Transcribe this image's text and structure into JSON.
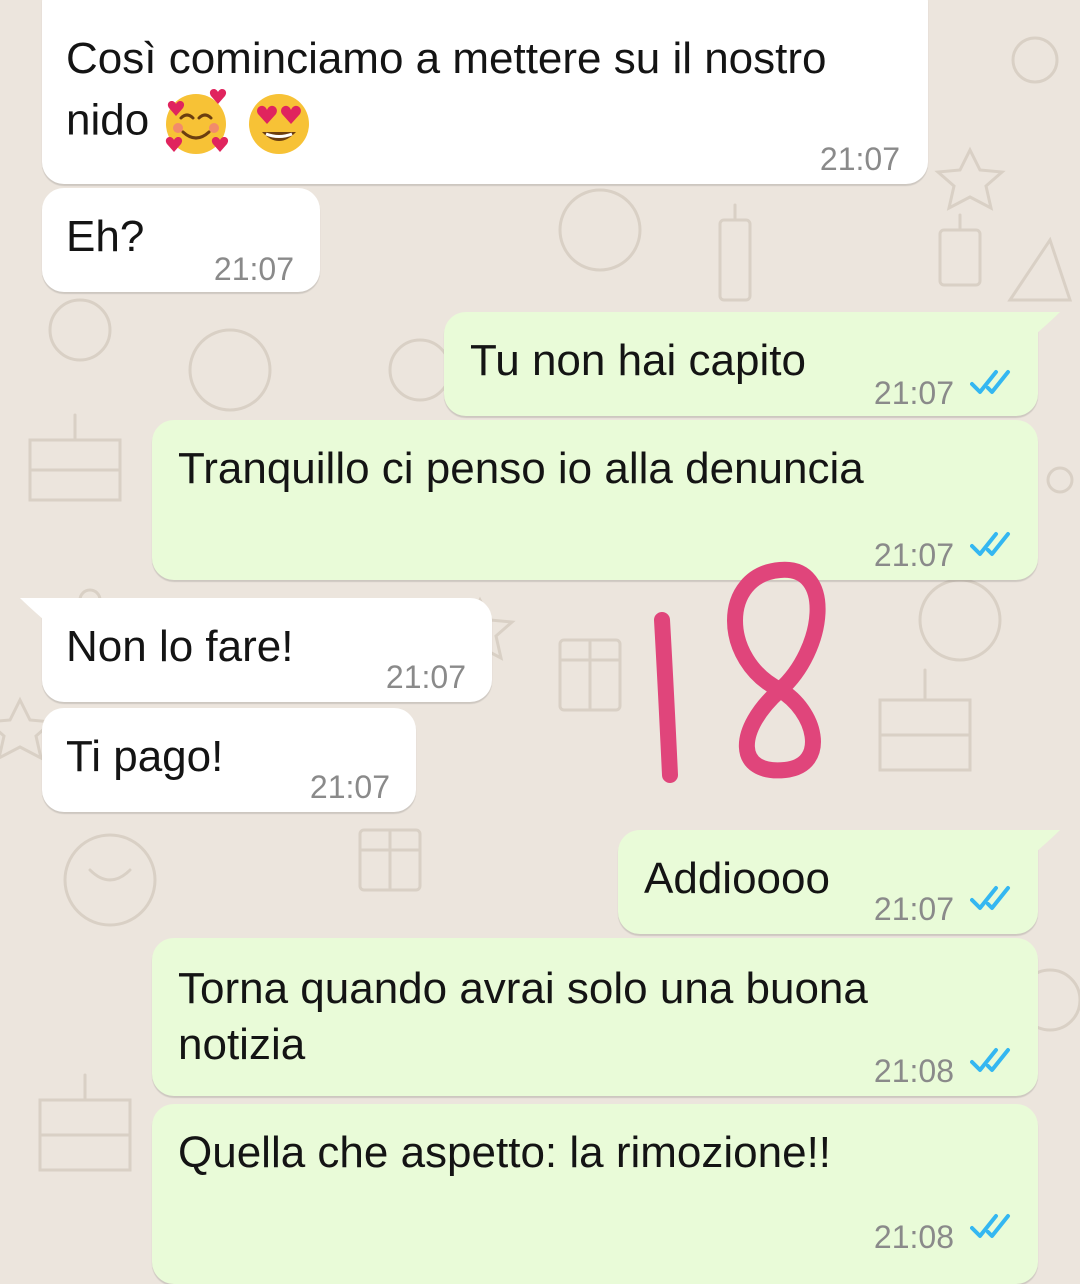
{
  "colors": {
    "wallpaper": "#ece5dd",
    "incoming_bubble": "#ffffff",
    "outgoing_bubble": "#e9fbd8",
    "read_ticks": "#34b7f1",
    "scribble": "#e0457b"
  },
  "messages": [
    {
      "direction": "incoming",
      "text_line1": "Così cominciamo a mettere su il nostro",
      "text_line2": "nido",
      "emojis": [
        "smiling-face-with-hearts-icon",
        "heart-eyes-icon"
      ],
      "time": "21:07"
    },
    {
      "direction": "incoming",
      "text": "Eh?",
      "time": "21:07"
    },
    {
      "direction": "outgoing",
      "text": "Tu non hai capito",
      "time": "21:07",
      "status": "read"
    },
    {
      "direction": "outgoing",
      "text": "Tranquillo ci penso io alla denuncia",
      "time": "21:07",
      "status": "read"
    },
    {
      "direction": "incoming",
      "text": "Non lo fare!",
      "time": "21:07"
    },
    {
      "direction": "incoming",
      "text": "Ti pago!",
      "time": "21:07"
    },
    {
      "direction": "outgoing",
      "text": "Addioooo",
      "time": "21:07",
      "status": "read"
    },
    {
      "direction": "outgoing",
      "text_line1": "Torna quando avrai solo una buona",
      "text_line2": "notizia",
      "time": "21:08",
      "status": "read"
    },
    {
      "direction": "outgoing",
      "text": "Quella che aspetto: la rimozione!!",
      "time": "21:08",
      "status": "read"
    }
  ],
  "annotation": {
    "text": "18",
    "style": "handwritten"
  }
}
